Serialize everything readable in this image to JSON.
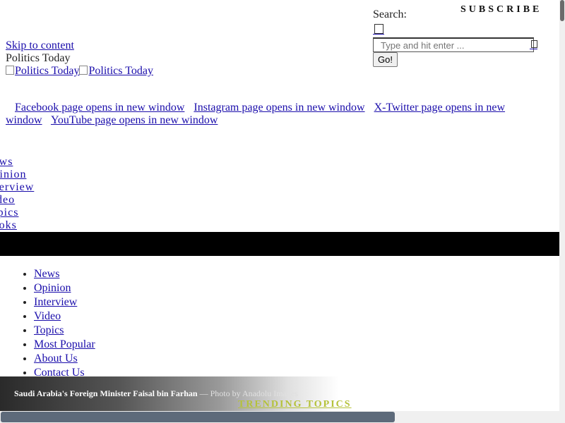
{
  "header": {
    "skip_link": "Skip to content",
    "site_name": "Politics Today",
    "logo_alt_1": "Politics Today",
    "logo_alt_2": "Politics Today",
    "subscribe_label": "SUBSCRIBE"
  },
  "search": {
    "label": "Search:",
    "placeholder": "Type and hit enter ...",
    "go_label": "Go!"
  },
  "social": {
    "facebook": "Facebook page opens in new window",
    "instagram": "Instagram page opens in new window",
    "twitter": "X-Twitter page opens in new window",
    "youtube": "YouTube page opens in new window"
  },
  "side_nav": {
    "items": [
      "News",
      "Opinion",
      "Interview",
      "Video",
      "Topics",
      "Books"
    ]
  },
  "main_menu": {
    "items": [
      "News",
      "Opinion",
      "Interview",
      "Video",
      "Topics",
      "Most Popular",
      "About Us",
      "Contact Us"
    ]
  },
  "caption": {
    "name": "Saudi Arabia's Foreign Minister Faisal bin Farhan",
    "credit": " — Photo by Anadolu Images"
  },
  "trending": {
    "label": "TRENDING TOPICS"
  },
  "colors": {
    "link": "#1a0dab",
    "trending": "#b5c23a",
    "black_bar": "#000000"
  }
}
